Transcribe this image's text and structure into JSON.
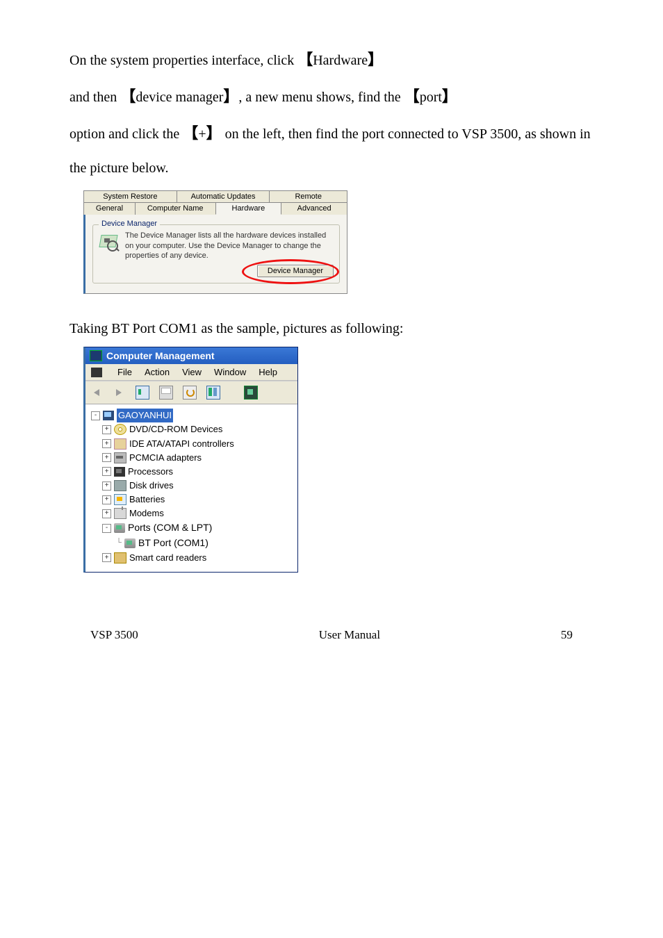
{
  "paragraph": {
    "line1_prefix": "On the system properties interface, click ",
    "link_hardware": "Hardware",
    "line2_prefix": "and then ",
    "link_devmgr": "device manager",
    "line2_mid": ", a new menu shows, find the ",
    "link_port": "port",
    "line3_prefix": "option and click the ",
    "link_plus": "+",
    "line3_suffix": " on the left, then find the port connected to VSP 3500, as shown in the picture below."
  },
  "sysprops": {
    "tabs_row1": [
      "System Restore",
      "Automatic Updates",
      "Remote"
    ],
    "tabs_row2": [
      "General",
      "Computer Name",
      "Hardware",
      "Advanced"
    ],
    "fieldset_legend": "Device Manager",
    "fieldset_text": "The Device Manager lists all the hardware devices installed on your computer. Use the Device Manager to change the properties of any device.",
    "button": "Device Manager"
  },
  "sub_para": "Taking BT Port COM1 as the sample, pictures as following:",
  "cm": {
    "title": "Computer Management",
    "menu": [
      "File",
      "Action",
      "View",
      "Window",
      "Help"
    ],
    "root": "GAOYANHUI",
    "nodes": [
      {
        "label": "DVD/CD-ROM Devices",
        "icon": "ic-cd",
        "exp": "+"
      },
      {
        "label": "IDE ATA/ATAPI  controllers",
        "icon": "ic-ide",
        "exp": "+"
      },
      {
        "label": "PCMCIA adapters",
        "icon": "ic-pcmcia",
        "exp": "+"
      },
      {
        "label": "Processors",
        "icon": "ic-proc",
        "exp": "+"
      },
      {
        "label": "Disk drives",
        "icon": "ic-disk",
        "exp": "+"
      },
      {
        "label": "Batteries",
        "icon": "ic-bat",
        "exp": "+"
      },
      {
        "label": "Modems",
        "icon": "ic-modem",
        "exp": "+"
      }
    ],
    "ports_label": "Ports (COM & LPT)",
    "ports_exp": "-",
    "bt_port": "BT Port  (COM1)",
    "smart": "Smart card readers"
  },
  "footer": {
    "left": "VSP 3500",
    "center": "User Manual",
    "right": "59"
  }
}
